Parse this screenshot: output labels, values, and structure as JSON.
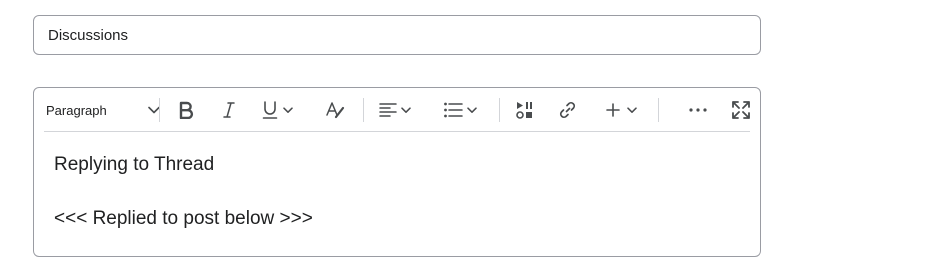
{
  "subject": {
    "value": "Discussions"
  },
  "toolbar": {
    "block_format": "Paragraph",
    "icons": [
      "chevron-down-icon",
      "bold-icon",
      "italic-icon",
      "underline-icon",
      "text-format-icon",
      "align-left-icon",
      "bullet-list-icon",
      "insert-stuff-icon",
      "link-icon",
      "plus-icon",
      "more-icon",
      "fullscreen-icon"
    ]
  },
  "content": {
    "line1": "Replying to Thread",
    "line2": "<<< Replied to post below >>>"
  }
}
